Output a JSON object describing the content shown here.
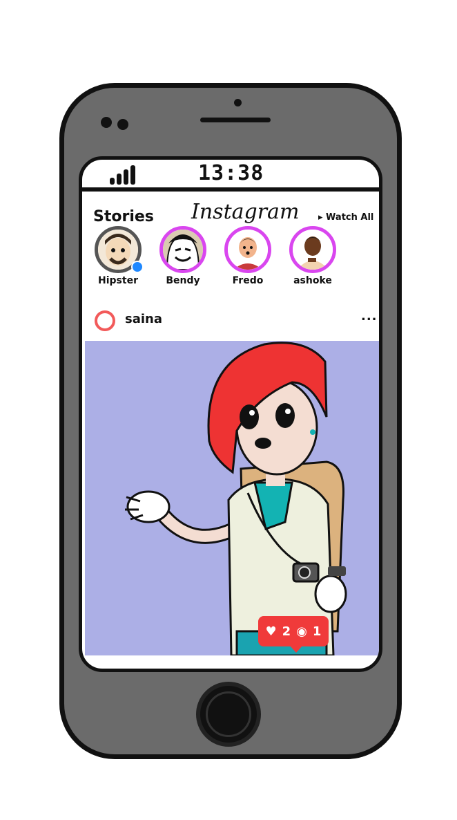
{
  "status_bar": {
    "time": "13:38"
  },
  "header": {
    "stories_label": "Stories",
    "brand": "Instagram",
    "watch_all": "▸ Watch All"
  },
  "stories": [
    {
      "name": "Hipster",
      "ring_color": "#555555"
    },
    {
      "name": "Bendy",
      "ring_color": "#d946ef"
    },
    {
      "name": "Fredo",
      "ring_color": "#d946ef"
    },
    {
      "name": "ashoke",
      "ring_color": "#d946ef"
    }
  ],
  "post": {
    "username": "saina",
    "more": "...",
    "ring_color": "#f25a5a"
  },
  "notification": {
    "likes": "2",
    "comments": "1",
    "color": "#f03a3a"
  },
  "colors": {
    "phone_body": "#6b6b6b",
    "photo_bg": "#acafe6",
    "hair": "#ee3333"
  },
  "icons": [
    "signal-icon",
    "heart-icon",
    "comment-icon",
    "home-button-icon"
  ]
}
